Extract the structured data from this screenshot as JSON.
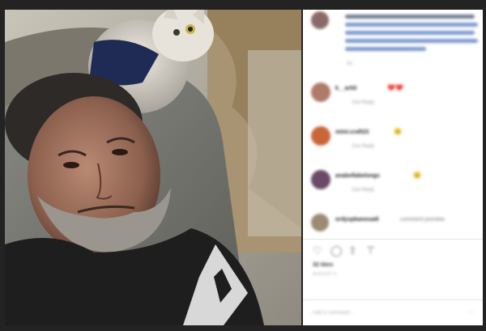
{
  "post": {
    "caption": {
      "username": "",
      "text_lines": [
        "",
        "",
        "",
        ""
      ],
      "time_ago": "4d"
    },
    "comments": [
      {
        "username": "k__artiii",
        "emoji": "❤️❤️",
        "meta": "21w  Reply"
      },
      {
        "username": "mimi.craft23",
        "emoji": "😊",
        "meta": "21w  Reply"
      },
      {
        "username": "anabellabelongs",
        "emoji": "😊",
        "meta": "21w  Reply"
      },
      {
        "username": "ordyspkanosadi",
        "emoji": "",
        "meta": "",
        "text": "comment preview"
      }
    ],
    "actions": {
      "like_icon": "heart-icon",
      "comment_icon": "speech-bubble-icon",
      "share_icon": "share-arrow-icon",
      "save_icon": "bookmark-icon"
    },
    "likes": "32 likes",
    "timestamp": "AUGUST 5",
    "add_comment_placeholder": "Add a comment...",
    "more_icon": "ellipsis-icon"
  },
  "colors": {
    "panel_bg": "#ffffff",
    "frame_bg": "#232323",
    "caption_text": "#5a87c7"
  }
}
